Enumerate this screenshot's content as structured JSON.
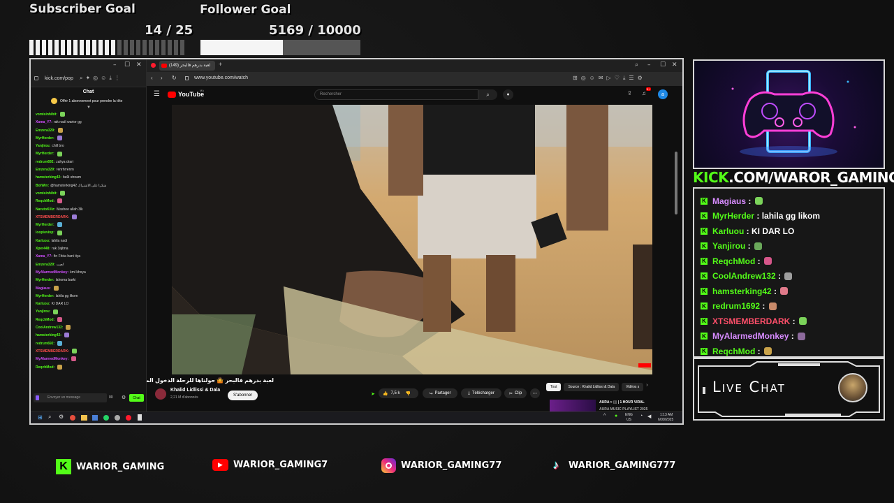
{
  "goals": {
    "subscriber": {
      "title": "Subscriber Goal",
      "count": "14 / 25",
      "current": 14,
      "target": 25
    },
    "follower": {
      "title": "Follower Goal",
      "count": "5169 / 10000",
      "current": 5169,
      "target": 10000
    }
  },
  "kick_window": {
    "url": "kick.com/pop",
    "chat_title": "Chat",
    "pinned": "Offrir 1 abonnement pour prendre la tête",
    "messages": [
      {
        "user": "vomisinhibit:",
        "text": "",
        "color": "#53fc18"
      },
      {
        "user": "Xama_Y7:",
        "text": "rak nadi warior gg",
        "color": "#d14fff"
      },
      {
        "user": "Emzera329:",
        "text": "",
        "color": "#53fc18"
      },
      {
        "user": "MyrHerder:",
        "text": "",
        "color": "#53fc18"
      },
      {
        "user": "Yanjirou:",
        "text": "chill bro",
        "color": "#53fc18"
      },
      {
        "user": "MyrHerder:",
        "text": "",
        "color": "#53fc18"
      },
      {
        "user": "redrum692:",
        "text": "zahya drari",
        "color": "#53fc18"
      },
      {
        "user": "Emzera329:",
        "text": "renrhrrenrn",
        "color": "#53fc18"
      },
      {
        "user": "hamsterking42:",
        "text": "ba9i stream",
        "color": "#53fc18"
      },
      {
        "user": "BotWin:",
        "text": "@hamsterking42 شكرا على الاشتراك",
        "color": "#53fc18"
      },
      {
        "user": "vomisinhibit:",
        "text": "",
        "color": "#53fc18"
      },
      {
        "user": "ReqchMod:",
        "text": "",
        "color": "#53fc18"
      },
      {
        "user": "NarutoKillz:",
        "text": "Mashee allah 3lk",
        "color": "#53fc18"
      },
      {
        "user": "XTSMEMBERDARK:",
        "text": "",
        "color": "#ff4d4d"
      },
      {
        "user": "MyrHerder:",
        "text": "",
        "color": "#53fc18"
      },
      {
        "user": "loopiovinp:",
        "text": "",
        "color": "#53fc18"
      },
      {
        "user": "Karluou:",
        "text": "lahila nadi",
        "color": "#53fc18"
      },
      {
        "user": "Xper448:",
        "text": "rak 3ajbna",
        "color": "#53fc18"
      },
      {
        "user": "Xama_Y7:",
        "text": "fin Frkta hani tiya",
        "color": "#d14fff"
      },
      {
        "user": "Emzera329:",
        "text": "لعبت",
        "color": "#53fc18"
      },
      {
        "user": "MyAlarmedMonkey:",
        "text": "kml khoya",
        "color": "#d14fff"
      },
      {
        "user": "MyrHerder:",
        "text": "lahoma barki",
        "color": "#53fc18"
      },
      {
        "user": "Magiaus:",
        "text": "",
        "color": "#d14fff"
      },
      {
        "user": "MyrHerder:",
        "text": "lahila gg likom",
        "color": "#53fc18"
      },
      {
        "user": "Karluou:",
        "text": "KI DAR LO",
        "color": "#53fc18"
      },
      {
        "user": "Yanjirou:",
        "text": "",
        "color": "#53fc18"
      },
      {
        "user": "ReqchMod:",
        "text": "",
        "color": "#53fc18"
      },
      {
        "user": "CoolAndrew132:",
        "text": "",
        "color": "#53fc18"
      },
      {
        "user": "hamsterking42:",
        "text": "",
        "color": "#53fc18"
      },
      {
        "user": "redrum692:",
        "text": "",
        "color": "#53fc18"
      },
      {
        "user": "XTSMEMBERDARK:",
        "text": "",
        "color": "#ff4d4d"
      },
      {
        "user": "MyAlarmedMonkey:",
        "text": "",
        "color": "#d14fff"
      },
      {
        "user": "ReqchMod:",
        "text": "",
        "color": "#53fc18"
      }
    ],
    "input_placeholder": "Envoyer un message",
    "counter": "00",
    "chat_button": "Chat"
  },
  "youtube_window": {
    "tab_title": "(149) لعبة بدرهم فالبحر",
    "url": "www.youtube.com/watch",
    "logo": "YouTube",
    "country": "MA",
    "search_placeholder": "Rechercher",
    "notif_count": "9+",
    "video_title": "لعبة بدرهم فالبحر 🤷 حولناها للرحلة الدخول المدرسي !!!",
    "channel": "Khalid Lidlissi & Dala",
    "subscribers": "2,21 M d'abonnés",
    "subscribe_label": "S'abonner",
    "likes": "7,5 k",
    "share_label": "Partager",
    "download_label": "Télécharger",
    "clip_label": "Clip",
    "chips": [
      "Tout",
      "Source : Khalid Lidlissi & Dala",
      "Vidéos s"
    ],
    "rec_title_1": "AURA ≈ ▯▯ | 1 HOUR VIRAL",
    "rec_title_2": "AURA MUSIC PLAYLIST 2025"
  },
  "taskbar": {
    "lang_1": "ENG",
    "lang_2": "US",
    "time": "1:13 AM",
    "date": "6/09/2025"
  },
  "right_panel": {
    "kick_brand": "KICK",
    "kick_rest": ".COM/WAROR_GAMING",
    "kick_green": "#53fc18",
    "chat": [
      {
        "user": "Magiaus",
        "text": "",
        "color": "#d78bff"
      },
      {
        "user": "MyrHerder",
        "text": "lahila gg likom",
        "color": "#53fc18"
      },
      {
        "user": "Karluou",
        "text": "KI DAR LO",
        "color": "#53fc18"
      },
      {
        "user": "Yanjirou",
        "text": "",
        "color": "#53fc18"
      },
      {
        "user": "ReqchMod",
        "text": "",
        "color": "#53fc18"
      },
      {
        "user": "CoolAndrew132",
        "text": "",
        "color": "#53fc18"
      },
      {
        "user": "hamsterking42",
        "text": "",
        "color": "#53fc18"
      },
      {
        "user": "redrum1692",
        "text": "",
        "color": "#53fc18"
      },
      {
        "user": "XTSMEMBERDARK",
        "text": "",
        "color": "#ff4f6a"
      },
      {
        "user": "MyAlarmedMonkey",
        "text": "",
        "color": "#d78bff"
      },
      {
        "user": "ReqchMod",
        "text": "",
        "color": "#53fc18"
      }
    ],
    "live_chat_label": "Live Chat"
  },
  "socials": [
    {
      "platform": "kick-icon",
      "handle": "WARIOR_GAMING"
    },
    {
      "platform": "youtube-icon",
      "handle": "WARIOR_GAMING7"
    },
    {
      "platform": "instagram-icon",
      "handle": "WARIOR_GAMING77"
    },
    {
      "platform": "tiktok-icon",
      "handle": "WARIOR_GAMING777"
    }
  ]
}
